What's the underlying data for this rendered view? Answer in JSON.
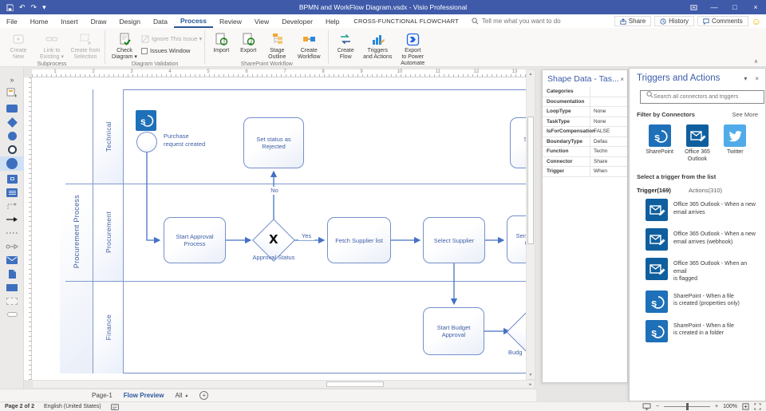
{
  "glyphs": {
    "undo": "↶",
    "redo": "↷",
    "caret_down": "▾",
    "caret_up": "▲",
    "minimize": "—",
    "restore": "□",
    "close": "×",
    "chevrons": "»",
    "plus": "+",
    "minus": "−",
    "collapse": "∧",
    "smiley": "☺",
    "scroll_up": "▲",
    "scroll_down": "▼",
    "scroll_left": "◄",
    "scroll_right": "►",
    "x_small": "×"
  },
  "colors": {
    "titlebar": "#3f5aa9",
    "accent": "#2b579a",
    "diagram_stroke": "#7490cb",
    "diagram_text": "#3f5fa6",
    "connector": "#4472c4",
    "sharepoint": "#1e70b8",
    "outlook": "#0f5f9e",
    "twitter": "#50abe8"
  },
  "titlebar": {
    "title": "BPMN and WorkFlow Diagram.vsdx - Visio Professional"
  },
  "menubar": {
    "tabs": [
      "File",
      "Home",
      "Insert",
      "Draw",
      "Design",
      "Data",
      "Process",
      "Review",
      "View",
      "Developer",
      "Help"
    ],
    "active_tab": "Process",
    "context_tab": "CROSS-FUNCTIONAL FLOWCHART",
    "tell_me": "Tell me what you want to do",
    "share_label": "Share",
    "history_label": "History",
    "comments_label": "Comments"
  },
  "ribbon": {
    "groups": [
      {
        "label": "Subprocess",
        "buttons": [
          {
            "label": "Create\nNew"
          },
          {
            "label": "Link to\nExisting ▾"
          },
          {
            "label": "Create from\nSelection"
          }
        ]
      },
      {
        "label": "Diagram Validation",
        "buttons": [
          {
            "label": "Check\nDiagram ▾"
          }
        ],
        "rows": [
          {
            "label": "Ignore This Issue ▾"
          },
          {
            "label": "Issues Window"
          }
        ]
      },
      {
        "label": "SharePoint Workflow",
        "buttons": [
          {
            "label": "Import"
          },
          {
            "label": "Export"
          },
          {
            "label": "Stage\nOutline"
          },
          {
            "label": "Create\nWorkflow"
          }
        ]
      },
      {
        "label": "",
        "buttons": [
          {
            "label": "Create\nFlow"
          },
          {
            "label": "Triggers\nand Actions"
          },
          {
            "label": "Export\nto Power\nAutomate"
          }
        ]
      }
    ]
  },
  "diagram": {
    "title": "Procurement Process",
    "lanes": [
      "Technical",
      "Procurement",
      "Finance"
    ],
    "ruler_numbers": [
      "1",
      "2",
      "3",
      "4",
      "5",
      "6",
      "7",
      "8",
      "9",
      "10",
      "11",
      "12",
      "13"
    ],
    "shapes": {
      "start_event_label": "Purchase\nrequest created",
      "set_status_rejected": "Set status as\nRejected",
      "set_status_partial": "Set\nA",
      "start_approval": "Start Approval\nProcess",
      "gateway_symbol": "X",
      "gateway_label": "Approval Status",
      "label_no": "No",
      "label_yes": "Yes",
      "fetch_supplier": "Fetch Supplier list",
      "select_supplier": "Select Supplier",
      "send_po_partial": "Send Pu\nto",
      "start_budget": "Start Budget\nApproval",
      "budget_gateway_partial": "Budg"
    }
  },
  "shape_data_panel": {
    "title": "Shape Data - Tas...",
    "rows": [
      {
        "name": "Categories",
        "value": ""
      },
      {
        "name": "Documentation",
        "value": ""
      },
      {
        "name": "LoopType",
        "value": "None"
      },
      {
        "name": "TaskType",
        "value": "None"
      },
      {
        "name": "IsForCompensation",
        "value": "FALSE"
      },
      {
        "name": "BoundaryType",
        "value": "Defau"
      },
      {
        "name": "Function",
        "value": "Techn"
      },
      {
        "name": "Connector",
        "value": "Share"
      },
      {
        "name": "Trigger",
        "value": "When"
      }
    ]
  },
  "triggers_panel": {
    "title": "Triggers and Actions",
    "search_placeholder": "Search all connectors and triggers",
    "filter_label": "Filter by Connectors",
    "see_more": "See More",
    "connectors": [
      {
        "label": "SharePoint"
      },
      {
        "label": "Office 365\nOutlook"
      },
      {
        "label": "Twitter"
      }
    ],
    "select_prompt": "Select a trigger from the list",
    "tab_triggers": "Trigger(169)",
    "tab_actions": "Actions(310)",
    "items": [
      {
        "icon": "outlook",
        "label": "Office 365 Outlook - When a new\nemail arrives"
      },
      {
        "icon": "outlook",
        "label": "Office 365 Outlook - When a new\nemail arrives (webhook)"
      },
      {
        "icon": "outlook",
        "label": "Office 365 Outlook - When an email\nis flagged"
      },
      {
        "icon": "sharepoint",
        "label": "SharePoint - When a file\nis created (properties only)"
      },
      {
        "icon": "sharepoint",
        "label": "SharePoint - When a file\nis created in a folder"
      }
    ]
  },
  "page_bar": {
    "page1": "Page-1",
    "active_page": "Flow Preview",
    "all_label": "All"
  },
  "status_bar": {
    "page_info": "Page 2 of 2",
    "language": "English (United States)",
    "zoom_level": "100%"
  }
}
